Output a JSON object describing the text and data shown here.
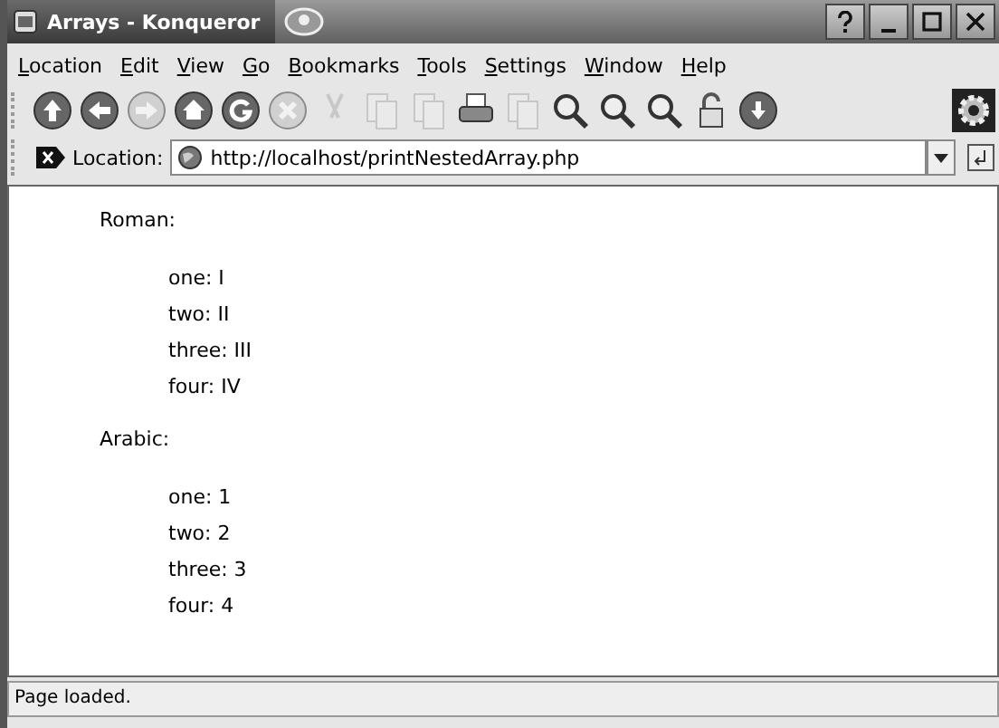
{
  "window": {
    "title": "Arrays - Konqueror"
  },
  "menu": [
    "Location",
    "Edit",
    "View",
    "Go",
    "Bookmarks",
    "Tools",
    "Settings",
    "Window",
    "Help"
  ],
  "toolbar": [
    {
      "kind": "up",
      "disabled": false
    },
    {
      "kind": "back",
      "disabled": false
    },
    {
      "kind": "forward",
      "disabled": true
    },
    {
      "kind": "home",
      "disabled": false
    },
    {
      "kind": "reload",
      "disabled": false
    },
    {
      "kind": "stop",
      "disabled": true
    },
    {
      "kind": "cut",
      "disabled": true
    },
    {
      "kind": "copy",
      "disabled": true
    },
    {
      "kind": "paste",
      "disabled": true
    },
    {
      "kind": "print",
      "disabled": false
    },
    {
      "kind": "preview",
      "disabled": true
    },
    {
      "kind": "zoom",
      "disabled": false
    },
    {
      "kind": "zoom",
      "disabled": false
    },
    {
      "kind": "zoom",
      "disabled": false
    },
    {
      "kind": "lock",
      "disabled": false
    },
    {
      "kind": "download",
      "disabled": false
    }
  ],
  "location": {
    "label": "Location:",
    "value": "http://localhost/printNestedArray.php"
  },
  "content": [
    {
      "heading": "Roman:",
      "items": [
        "one: I",
        "two: II",
        "three: III",
        "four: IV"
      ]
    },
    {
      "heading": "Arabic:",
      "items": [
        "one: 1",
        "two: 2",
        "three: 3",
        "four: 4"
      ]
    }
  ],
  "status_bar": "Page loaded."
}
